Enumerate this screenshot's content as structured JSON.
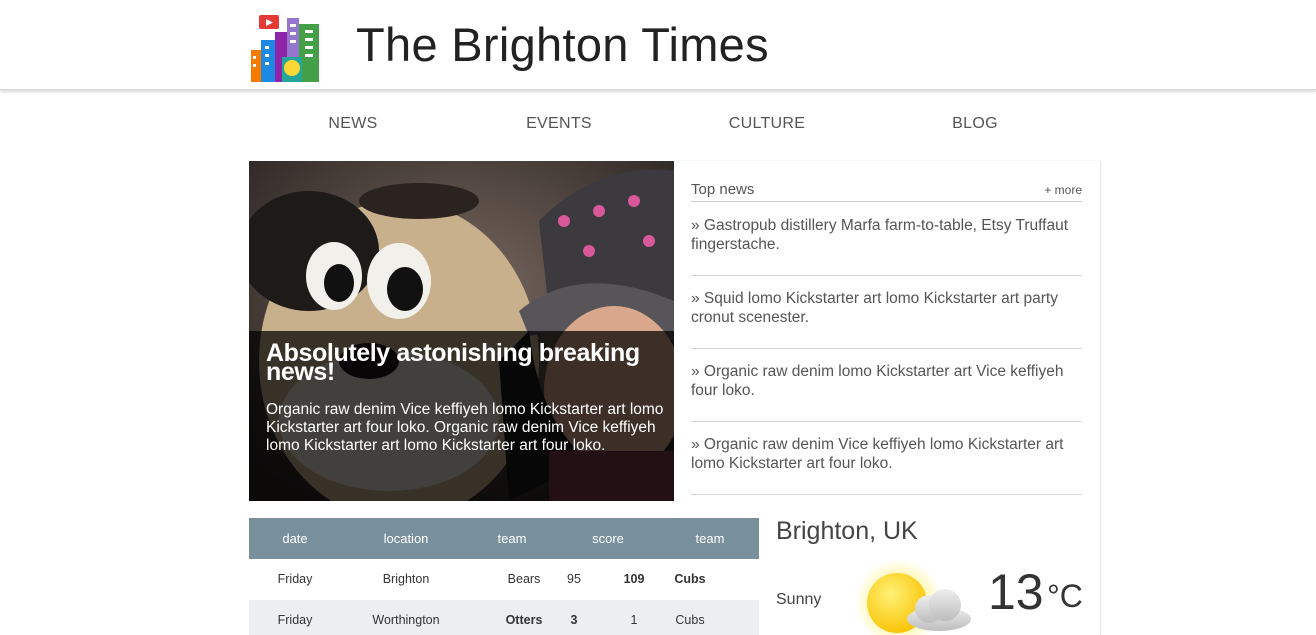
{
  "site": {
    "title": "The Brighton Times"
  },
  "nav": {
    "items": [
      "NEWS",
      "EVENTS",
      "CULTURE",
      "BLOG"
    ]
  },
  "hero": {
    "headline": "Absolutely astonishing breaking news!",
    "text": "Organic raw denim Vice keffiyeh lomo Kickstarter art lomo Kickstarter art four loko. Organic raw denim Vice keffiyeh lomo Kickstarter art lomo Kickstarter art four loko."
  },
  "top_news": {
    "title": "Top news",
    "more": "+ more",
    "items": [
      "» Gastropub distillery Marfa farm-to-table, Etsy Truffaut fingerstache.",
      "» Squid lomo Kickstarter art lomo Kickstarter art party cronut scenester.",
      "» Organic raw denim lomo Kickstarter art Vice keffiyeh four loko.",
      "» Organic raw denim Vice keffiyeh lomo Kickstarter art lomo Kickstarter art four loko."
    ]
  },
  "scores": {
    "headers": [
      "date",
      "location",
      "team",
      "score",
      "team"
    ],
    "rows": [
      {
        "date": "Friday",
        "location": "Brighton",
        "team1": "Bears",
        "score1": "95",
        "score2": "109",
        "team2": "Cubs"
      },
      {
        "date": "Friday",
        "location": "Worthington",
        "team1": "Otters",
        "score1": "3",
        "score2": "1",
        "team2": "Cubs"
      }
    ]
  },
  "weather": {
    "city": "Brighton, UK",
    "condition": "Sunny",
    "temperature": "13",
    "unit": "°C",
    "icon": "sun-cloud-icon"
  },
  "colors": {
    "table_header": "#78909c",
    "table_alt_row": "#eceff1",
    "hero_overlay": "rgba(0,0,0,0.72)"
  }
}
